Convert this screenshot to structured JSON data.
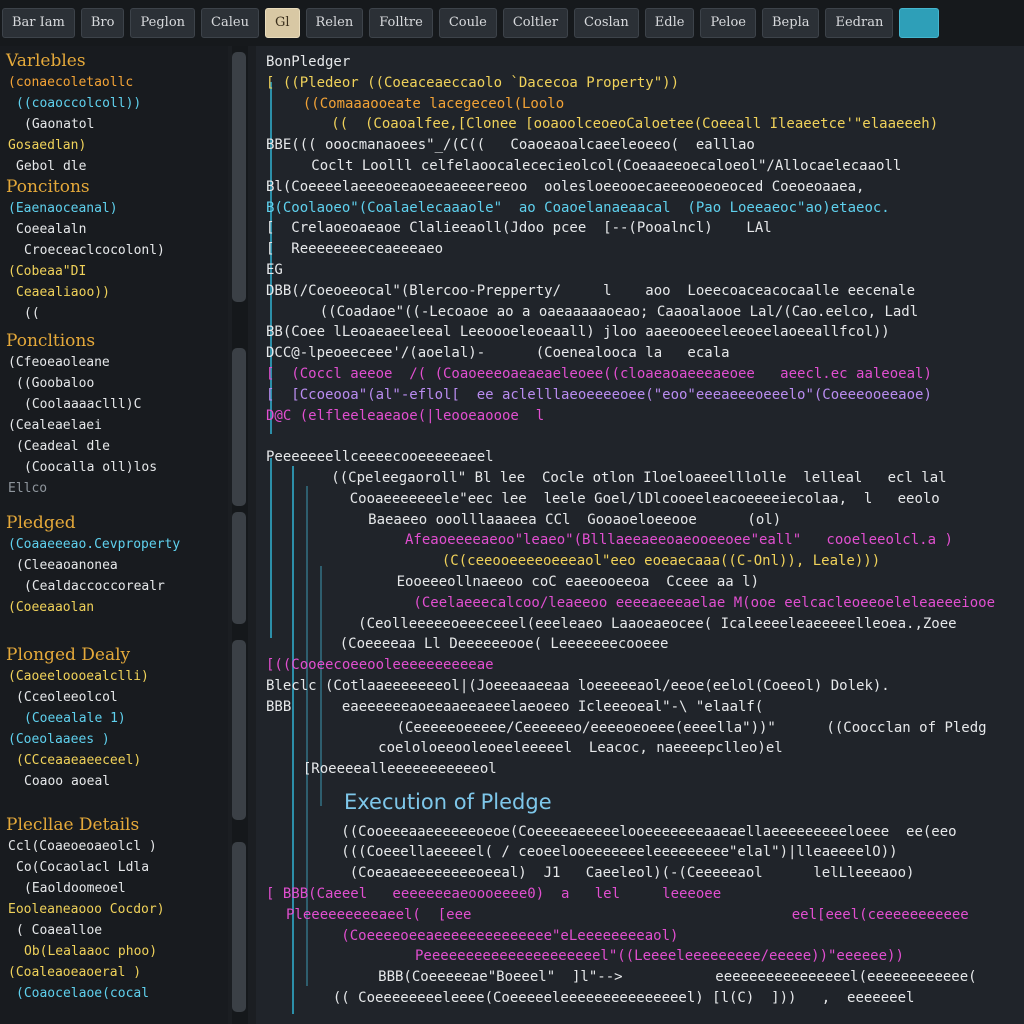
{
  "toolbar": {
    "buttons": [
      "Bar Iam",
      "Bro",
      "Peglon",
      "Caleu",
      "Gl",
      "Relen",
      "Folltre",
      "Coule",
      "Coltler",
      "Coslan",
      "Edle",
      "Peloe",
      "Bepla",
      "Eedran",
      ""
    ]
  },
  "sidebar": {
    "sections": [
      {
        "title": "Varlebles",
        "lines": [
          "(conaecoletaollc",
          "((coaoccolcoll))",
          "(Gaonatol",
          "Gosaedlan)",
          "Gebol dle"
        ]
      },
      {
        "title": "Poncitons",
        "lines": [
          "(Eaenaoceanal)",
          "Coeealaln",
          "Croeceaclcocolonl)",
          "(Cobeaa\"DI",
          "Ceaealiaoo))",
          "(("
        ]
      },
      {
        "title": "Poncltions",
        "lines": [
          "(Cfeoeaoleane",
          "((Goobaloo",
          "(Coolaaaaclll)C",
          "(Cealeaelaei",
          "(Ceadeal dle",
          "(Coocalla oll)los",
          "Ellco"
        ]
      },
      {
        "title": "Pledged",
        "lines": [
          "(Coaaeeeao.Cevproperty",
          "(Cleeaoanonea",
          "(Cealdaccoccorealr",
          "(Coeeaaolan"
        ]
      },
      {
        "title": "Plonged Dealy",
        "lines": [
          "(Caoeeloooealclli)",
          "(Cceoleeolcol",
          "(Coeealale 1)",
          "(Coeolaaees )",
          "(CCceaaeaeeceel)",
          "Coaoo aoeal"
        ]
      },
      {
        "title": "Plecllae Details",
        "lines": [
          "Ccl(Coaeoeoaeolcl )",
          "Co(Cocaolacl Ldla",
          "(Eaoldoomeoel",
          "Eooleaneaooo Cocdor)",
          "( Coaealloe",
          "Ob(Lealaaoc phoo)",
          "(Coaleaoeaoeral )",
          "(Coaocelaoe(cocal"
        ]
      }
    ]
  },
  "editor": {
    "lines": [
      {
        "text": "BonPledger",
        "color": "white"
      },
      {
        "text": "[ ((Pledeor ((Coeaceaeccaolo `Dacecoa Property\"))",
        "color": "yellow"
      },
      {
        "text": "  ((Comaaaooeate lacegeceol(Loolo",
        "color": "orange"
      },
      {
        "text": "   ((  (Coaoalfee,[Clonee [ooaoolceoeoCaloetee(Coeeall Ileaeetce'\"elaaeeeh)",
        "color": "yellow"
      },
      {
        "text": "BBE((( ooocmanaoees\"_/(C((   Coaoeaoalcaeeleoeeo(  ealllao",
        "color": "white"
      },
      {
        "text": "   Coclt Loolll celfelaoocalececieolcol(Coeaaeeoecaloeol\"/Allocaelecaaoll",
        "color": "white"
      },
      {
        "text": "Bl(Coeeeelaeeeoeeaoeeaeeeereeoo  oolesloeeooecaeeeooeoeoced Coeoeoaaea,",
        "color": "white"
      },
      {
        "text": "B(Coolaoeo\"(Coalaelecaaaole\"  ao Coaoelanaeaacal  (Pao Loeeaeoc\"ao)etaeoc.",
        "color": "cyan"
      },
      {
        "text": "[  Crelaoeoaeaoe Clalieeaoll(Jdoo pcee  [--(Pooalncl)    LAl",
        "color": "white"
      },
      {
        "text": "[  Reeeeeeeeceaeeeaeo",
        "color": "white"
      },
      {
        "text": "EG",
        "color": "white"
      },
      {
        "text": "DBB(/Coeoeeocal\"(Blercoo-Prepperty/     l    aoo  Loeecoaceacocaalle eecenale",
        "color": "white"
      },
      {
        "text": "    ((Coadaoe\"((-Lecoaoe ao a oaeaaaaaoeao; Caaoalaooe Lal/(Cao.eelco, Ladl",
        "color": "white"
      },
      {
        "text": "BB(Coee lLeoaeaeeleeal Leeoooeleoeaall) jloo aaeeooeeeleeoeelaoeeallfcol))",
        "color": "white"
      },
      {
        "text": "DCC@-lpeoeeceee'/(aoelal)-      (Coenealooca la   ecala",
        "color": "white"
      },
      {
        "text": "[  (Coccl aeeoe  /( (Coaoeeeoaeaeaeleoee((cloaeaoaeeeaeoee   aeecl.ec aaleoeal)",
        "color": "magenta"
      },
      {
        "text": "[  [Ccoeooa\"(al\"-eflol[  ee aclelllaeoeeeeoee(\"eoo\"eeeaeeeoeeelo\"(Coeeeooeeaoe)",
        "color": "violet"
      },
      {
        "text": "D@C (elfleeleaeaoe(|leooeaoooe  l",
        "color": "magenta"
      },
      {
        "text": "",
        "color": "white"
      },
      {
        "text": "Peeeeeeellceeeecooeeeeeaeel",
        "color": "white"
      },
      {
        "text": "   ((Cpeleegaoroll\" Bl lee  Cocle otlon Iloeloaeeelllolle  lelleal   ecl lal",
        "color": "white"
      },
      {
        "text": "    Cooaeeeeeeele\"eec lee  leele Goel/lDlcooeeleacoeeeeiecolaa,  l   eeolo",
        "color": "white"
      },
      {
        "text": "     Baeaeeo ooolllaaaeea CCl  Gooaoeloeeooe      (ol)",
        "color": "white"
      },
      {
        "text": "       Afeaoeeeeaeoo\"leaeo\"(Blllaeeaeeoaeooeeoee\"eall\"   cooeleeolcl.a )",
        "color": "magenta"
      },
      {
        "text": "         (C(ceeooeeeeoeeeaol\"eeo eoeaecaaa((C-Onl)), Leale)))",
        "color": "yellow"
      },
      {
        "text": "      Eooeeeollnaeeoo coC eaeeooeeoa  Cceee aa l)",
        "color": "white"
      },
      {
        "text": "        (Ceelaeeecalcoo/leaeeoo eeeeaeeeaelae M(ooe eelcacleoeeoeleleaeeeiooe",
        "color": "magenta"
      },
      {
        "text": "     (Ceolleeeeeoeeeceeel(eeeleaeo Laaoeaeocee( Icaleeeeleaeeeeelleoea.,Zoee",
        "color": "white"
      },
      {
        "text": "    (Coeeeeaa Ll Deeeeeeooe( Leeeeeeecooeee",
        "color": "white"
      },
      {
        "text": "[((Cooeecoeeooleeeeeeeeeeae",
        "color": "magenta"
      },
      {
        "text": "Bleclc (Cotlaaeeeeeeeol|(Joeeeaaeeaa loeeeeeaol/eeoe(eelol(Coeeol) Dolek).",
        "color": "white"
      },
      {
        "text": "BBB      eaeeeeeeaoeeaaeeaeeelaeoeeo Icleeeoeal\"-\\ \"elaalf(",
        "color": "white"
      },
      {
        "text": "      (Ceeeeeoeeeee/Ceeeeeeo/eeeeoeoeee(eeeella\"))\"      ((Coocclan of Pledg",
        "color": "white"
      },
      {
        "text": "     coeloloeeooleoeeleeeeel  Leacoc, naeeeepclleo)el",
        "color": "white"
      },
      {
        "text": "  [Roeeeealleeeeeeeeeeeol",
        "color": "white"
      },
      {
        "text": "",
        "color": "white"
      },
      {
        "text": "",
        "color": "white"
      },
      {
        "text": "   ((Cooeeeaaeeeeeeoeoe(Coeeeeaeeeeelooeeeeeeeaaeaellaeeeeeeeeeloeee  ee(eeo",
        "color": "white"
      },
      {
        "text": "   (((Coeeellaeeeeel( / ceoeelooeeeeeeeleeeeeeeee\"elal\")|lleaeeeelO))",
        "color": "white"
      },
      {
        "text": "    (Coeaeaeeeeeeeeoeeal)  J1   Caeeleol)(-(Ceeeeeaol      lelLleeeaoo)",
        "color": "white"
      },
      {
        "text": "[ BBB(Caeeel   eeeeeeeaeoooeeee0)  a   lel     leeeoee",
        "color": "magenta"
      },
      {
        "text": "Pleeeeeeeeeaeel(  [eee                                      eel[eeel(ceeeeeeeeeee",
        "color": "magenta"
      },
      {
        "text": "   (Coeeeeoeeaeeeeeeeeeeeeee\"eLeeeeeeeeaol)",
        "color": "magenta"
      },
      {
        "text": "       Peeeeeeeeeeeeeeeeeeeeel\"((Leeeeleeeeeeeee/eeeee))\"eeeeee))",
        "color": "magenta"
      },
      {
        "text": "     BBB(Coeeeeeae\"Boeeel\"  ]l\"-->           eeeeeeeeeeeeeeeel(eeeeeeeeeeee(",
        "color": "white"
      },
      {
        "text": "  (( Coeeeeeeeeleeee(Coeeeeeleeeeeeeeeeeeeeel) [l(C)  ]))   ,  eeeeeeel",
        "color": "white"
      }
    ],
    "heading": "Execution of Pledge"
  }
}
